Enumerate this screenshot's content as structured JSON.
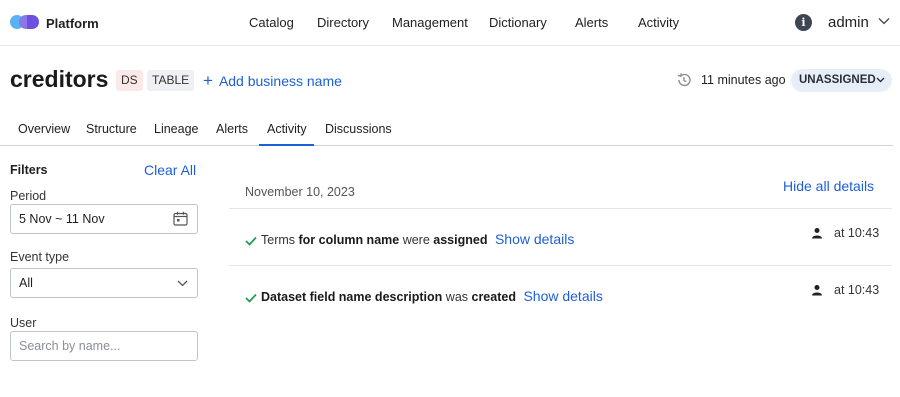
{
  "app": {
    "brand": "Platform",
    "nav": [
      "Catalog",
      "Directory",
      "Management",
      "Dictionary",
      "Alerts",
      "Activity"
    ],
    "user": "admin"
  },
  "dataset": {
    "name": "creditors",
    "tag_ds": "DS",
    "tag_table": "TABLE",
    "add_business_name": "Add business name",
    "updated": "11 minutes ago",
    "assignment": "UNASSIGNED"
  },
  "tabs": [
    "Overview",
    "Structure",
    "Lineage",
    "Alerts",
    "Activity",
    "Discussions"
  ],
  "active_tab": "Activity",
  "filters": {
    "title": "Filters",
    "clear_all": "Clear All",
    "period_label": "Period",
    "period_value": "5 Nov ~ 11 Nov",
    "event_type_label": "Event type",
    "event_type_value": "All",
    "user_label": "User",
    "user_placeholder": "Search by name..."
  },
  "activity": {
    "date": "November 10, 2023",
    "hide_all": "Hide all details",
    "events": [
      {
        "parts": [
          {
            "text": "Terms",
            "bold": false
          },
          {
            "text": " for column name",
            "bold": true
          },
          {
            "text": " were",
            "bold": false
          },
          {
            "text": " assigned",
            "bold": true
          }
        ],
        "show_details": "Show details",
        "time": "at 10:43"
      },
      {
        "parts": [
          {
            "text": "Dataset field name description",
            "bold": true
          },
          {
            "text": " was",
            "bold": false
          },
          {
            "text": " created",
            "bold": true
          }
        ],
        "show_details": "Show details",
        "time": "at 10:43"
      }
    ]
  },
  "colors": {
    "accent": "#1e5fd6",
    "success": "#1f9d55",
    "assign_bg": "#e8eef8"
  }
}
